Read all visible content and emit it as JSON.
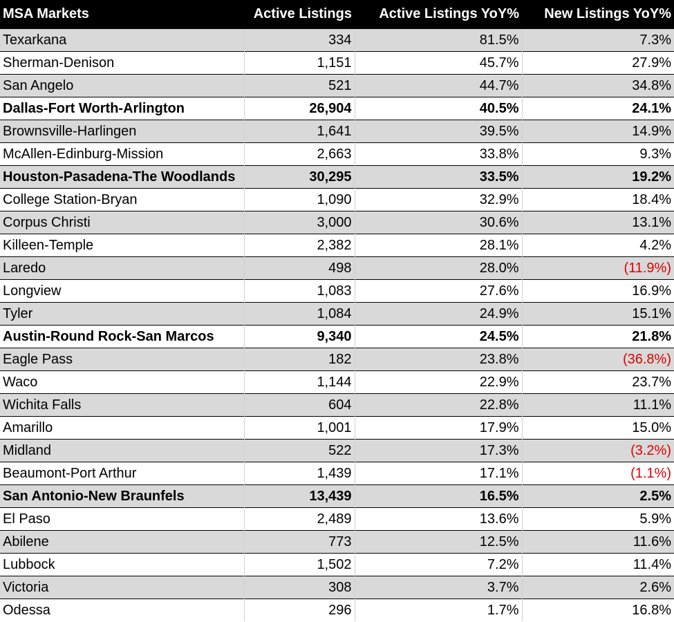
{
  "table": {
    "headers": [
      "MSA Markets",
      "Active Listings",
      "Active Listings YoY%",
      "New Listings YoY%"
    ],
    "rows": [
      {
        "name": "Texarkana",
        "active": "334",
        "active_yoy": "81.5%",
        "new_yoy": "7.3%",
        "bold": false
      },
      {
        "name": "Sherman-Denison",
        "active": "1,151",
        "active_yoy": "45.7%",
        "new_yoy": "27.9%",
        "bold": false
      },
      {
        "name": "San Angelo",
        "active": "521",
        "active_yoy": "44.7%",
        "new_yoy": "34.8%",
        "bold": false
      },
      {
        "name": "Dallas-Fort Worth-Arlington",
        "active": "26,904",
        "active_yoy": "40.5%",
        "new_yoy": "24.1%",
        "bold": true
      },
      {
        "name": "Brownsville-Harlingen",
        "active": "1,641",
        "active_yoy": "39.5%",
        "new_yoy": "14.9%",
        "bold": false
      },
      {
        "name": "McAllen-Edinburg-Mission",
        "active": "2,663",
        "active_yoy": "33.8%",
        "new_yoy": "9.3%",
        "bold": false
      },
      {
        "name": "Houston-Pasadena-The Woodlands",
        "active": "30,295",
        "active_yoy": "33.5%",
        "new_yoy": "19.2%",
        "bold": true
      },
      {
        "name": "College Station-Bryan",
        "active": "1,090",
        "active_yoy": "32.9%",
        "new_yoy": "18.4%",
        "bold": false
      },
      {
        "name": "Corpus Christi",
        "active": "3,000",
        "active_yoy": "30.6%",
        "new_yoy": "13.1%",
        "bold": false
      },
      {
        "name": "Killeen-Temple",
        "active": "2,382",
        "active_yoy": "28.1%",
        "new_yoy": "4.2%",
        "bold": false
      },
      {
        "name": "Laredo",
        "active": "498",
        "active_yoy": "28.0%",
        "new_yoy": "(11.9%)",
        "bold": false
      },
      {
        "name": "Longview",
        "active": "1,083",
        "active_yoy": "27.6%",
        "new_yoy": "16.9%",
        "bold": false
      },
      {
        "name": "Tyler",
        "active": "1,084",
        "active_yoy": "24.9%",
        "new_yoy": "15.1%",
        "bold": false
      },
      {
        "name": "Austin-Round Rock-San Marcos",
        "active": "9,340",
        "active_yoy": "24.5%",
        "new_yoy": "21.8%",
        "bold": true
      },
      {
        "name": "Eagle Pass",
        "active": "182",
        "active_yoy": "23.8%",
        "new_yoy": "(36.8%)",
        "bold": false
      },
      {
        "name": "Waco",
        "active": "1,144",
        "active_yoy": "22.9%",
        "new_yoy": "23.7%",
        "bold": false
      },
      {
        "name": "Wichita Falls",
        "active": "604",
        "active_yoy": "22.8%",
        "new_yoy": "11.1%",
        "bold": false
      },
      {
        "name": "Amarillo",
        "active": "1,001",
        "active_yoy": "17.9%",
        "new_yoy": "15.0%",
        "bold": false
      },
      {
        "name": "Midland",
        "active": "522",
        "active_yoy": "17.3%",
        "new_yoy": "(3.2%)",
        "bold": false
      },
      {
        "name": "Beaumont-Port Arthur",
        "active": "1,439",
        "active_yoy": "17.1%",
        "new_yoy": "(1.1%)",
        "bold": false
      },
      {
        "name": "San Antonio-New Braunfels",
        "active": "13,439",
        "active_yoy": "16.5%",
        "new_yoy": "2.5%",
        "bold": true
      },
      {
        "name": "El Paso",
        "active": "2,489",
        "active_yoy": "13.6%",
        "new_yoy": "5.9%",
        "bold": false
      },
      {
        "name": "Abilene",
        "active": "773",
        "active_yoy": "12.5%",
        "new_yoy": "11.6%",
        "bold": false
      },
      {
        "name": "Lubbock",
        "active": "1,502",
        "active_yoy": "7.2%",
        "new_yoy": "11.4%",
        "bold": false
      },
      {
        "name": "Victoria",
        "active": "308",
        "active_yoy": "3.7%",
        "new_yoy": "2.6%",
        "bold": false
      },
      {
        "name": "Odessa",
        "active": "296",
        "active_yoy": "1.7%",
        "new_yoy": "16.8%",
        "bold": false
      }
    ]
  },
  "colors": {
    "header_bg": "#000000",
    "header_text": "#ffffff",
    "band_gray": "#d9d9d9",
    "negative": "#e00000"
  }
}
